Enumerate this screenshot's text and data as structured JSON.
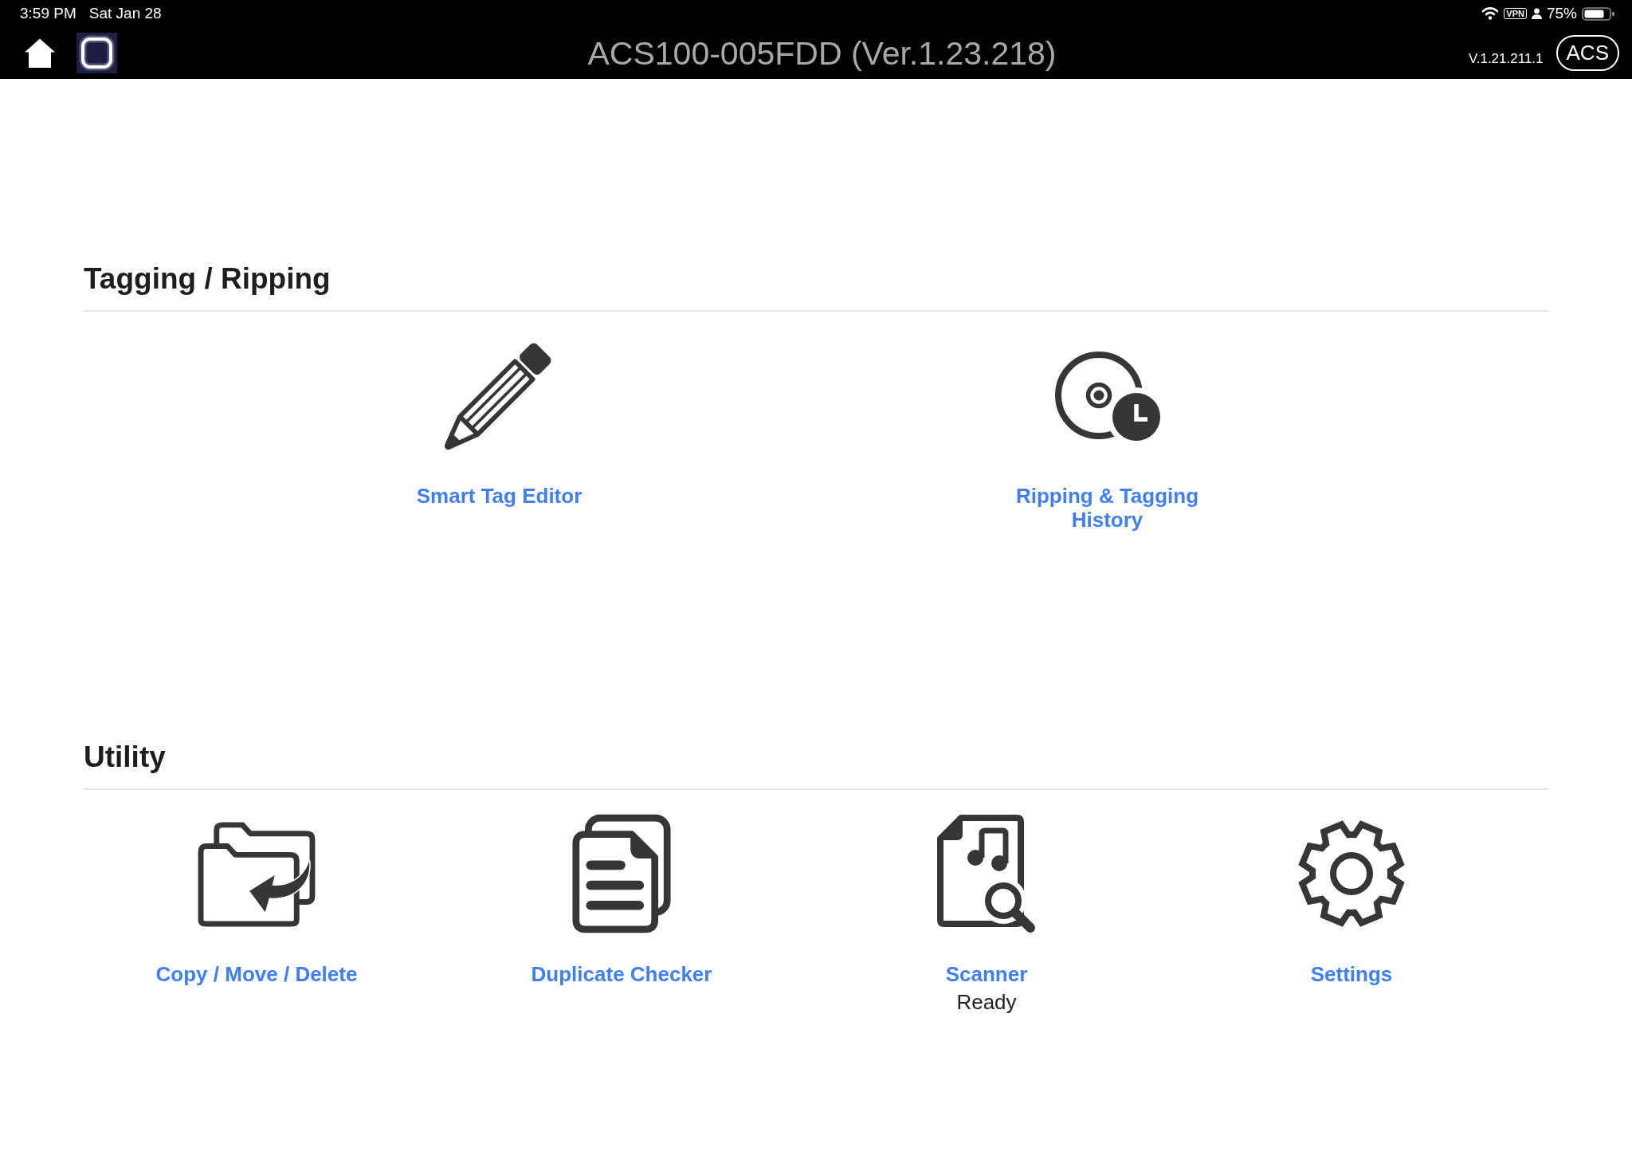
{
  "status_bar": {
    "time": "3:59 PM",
    "date": "Sat Jan 28",
    "vpn": "VPN",
    "battery_percent": "75%"
  },
  "nav_bar": {
    "title": "ACS100-005FDD (Ver.1.23.218)",
    "version": "V.1.21.211.1",
    "button": "ACS"
  },
  "sections": [
    {
      "title": "Tagging / Ripping",
      "items": [
        {
          "kind": "editor",
          "label": "Smart Tag Editor"
        },
        {
          "kind": "history",
          "label": "Ripping & Tagging History"
        }
      ]
    },
    {
      "title": "Utility",
      "items": [
        {
          "kind": "transfer",
          "label": "Copy / Move / Delete"
        },
        {
          "kind": "duplicates",
          "label": "Duplicate Checker"
        },
        {
          "kind": "scanner",
          "label": "Scanner",
          "status": "Ready"
        },
        {
          "kind": "settings",
          "label": "Settings"
        }
      ]
    }
  ]
}
